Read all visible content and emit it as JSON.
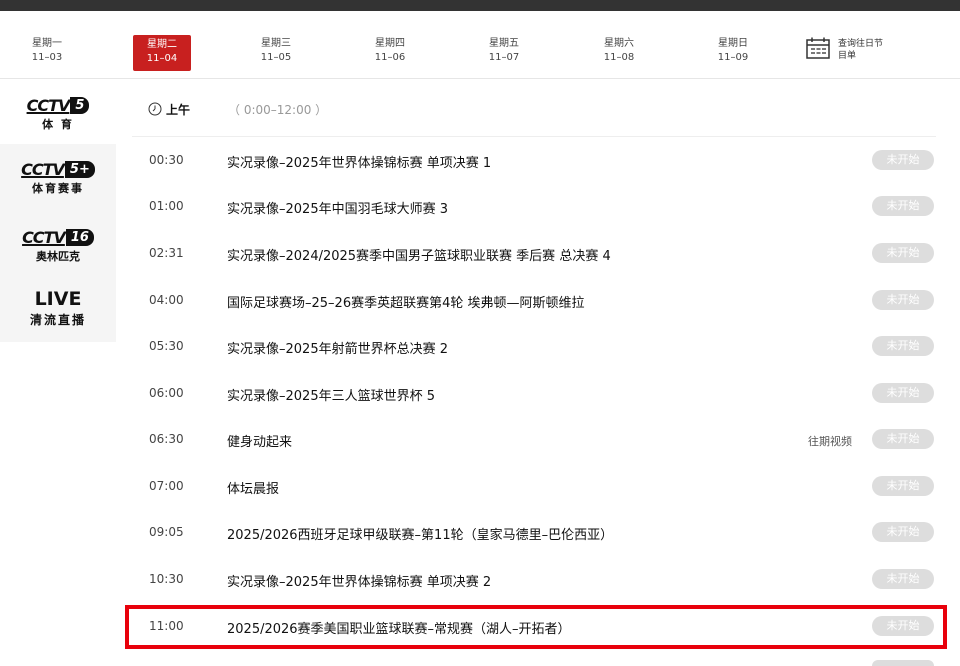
{
  "days": [
    {
      "name": "星期一",
      "date": "11–03"
    },
    {
      "name": "星期二",
      "date": "11–04"
    },
    {
      "name": "星期三",
      "date": "11–05"
    },
    {
      "name": "星期四",
      "date": "11–06"
    },
    {
      "name": "星期五",
      "date": "11–07"
    },
    {
      "name": "星期六",
      "date": "11–08"
    },
    {
      "name": "星期日",
      "date": "11–09"
    }
  ],
  "active_day": "星期二",
  "past_programs": {
    "line1": "查询往日节",
    "line2": "目单"
  },
  "channels": [
    {
      "logo": "CCTV",
      "num": "5",
      "sub": "体 育"
    },
    {
      "logo": "CCTV",
      "num": "5+",
      "sub": "体育赛事"
    },
    {
      "logo": "CCTV",
      "num": "16",
      "sub": "奥林匹克"
    },
    {
      "logo": "LIVE",
      "sub": "清流直播"
    }
  ],
  "section": {
    "period": "上午",
    "range": "（ 0:00–12:00 ）"
  },
  "programs": [
    {
      "time": "00:30",
      "title": "实况录像–2025年世界体操锦标赛 单项决赛 1",
      "status": "未开始"
    },
    {
      "time": "01:00",
      "title": "实况录像–2025年中国羽毛球大师赛 3",
      "status": "未开始"
    },
    {
      "time": "02:31",
      "title": "实况录像–2024/2025赛季中国男子篮球职业联赛 季后赛 总决赛 4",
      "status": "未开始"
    },
    {
      "time": "04:00",
      "title": "国际足球赛场–25–26赛季英超联赛第4轮 埃弗顿—阿斯顿维拉",
      "status": "未开始"
    },
    {
      "time": "05:30",
      "title": "实况录像–2025年射箭世界杯总决赛 2",
      "status": "未开始"
    },
    {
      "time": "06:00",
      "title": "实况录像–2025年三人篮球世界杯 5",
      "status": "未开始"
    },
    {
      "time": "06:30",
      "title": "健身动起来",
      "replay": "往期视频",
      "status": "未开始"
    },
    {
      "time": "07:00",
      "title": "体坛晨报",
      "status": "未开始"
    },
    {
      "time": "09:05",
      "title": "2025/2026西班牙足球甲级联赛–第11轮（皇家马德里–巴伦西亚）",
      "status": "未开始"
    },
    {
      "time": "10:30",
      "title": "实况录像–2025年世界体操锦标赛 单项决赛 2",
      "status": "未开始"
    },
    {
      "time": "11:00",
      "title": "2025/2026赛季美国职业篮球联赛–常规赛（湖人–开拓者）",
      "status": "未开始"
    }
  ],
  "colors": {
    "accent": "#c8201f",
    "highlight": "#e8000b",
    "status_bg": "#dddddd"
  }
}
